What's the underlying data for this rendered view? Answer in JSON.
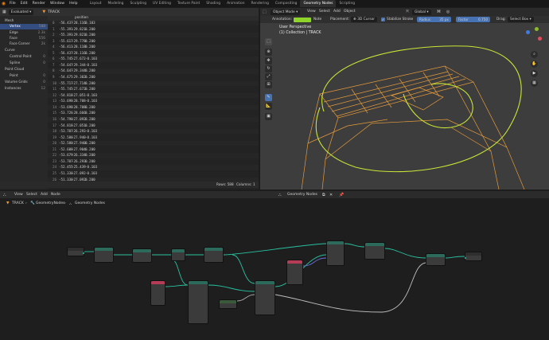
{
  "menu": {
    "logo": "blender-logo-icon",
    "items": [
      "File",
      "Edit",
      "Render",
      "Window",
      "Help"
    ],
    "workspace_tabs": [
      "Layout",
      "Modeling",
      "Sculpting",
      "UV Editing",
      "Texture Paint",
      "Shading",
      "Animation",
      "Rendering",
      "Compositing",
      "Geometry Nodes",
      "Scripting"
    ],
    "active_tab": "Geometry Nodes"
  },
  "spreadsheet": {
    "mode": "Evaluated",
    "object": "TRACK",
    "column_header": "position",
    "tree": [
      {
        "label": "Mesh",
        "count": ""
      },
      {
        "label": "Vertex",
        "count": "588",
        "selected": true
      },
      {
        "label": "Edge",
        "count": "2.3k"
      },
      {
        "label": "Face",
        "count": "556"
      },
      {
        "label": "Face Corner",
        "count": "2k"
      },
      {
        "label": "Curve",
        "count": ""
      },
      {
        "label": "Control Point",
        "count": "0"
      },
      {
        "label": "Spline",
        "count": "0"
      },
      {
        "label": "Point Cloud",
        "count": ""
      },
      {
        "label": "Point",
        "count": "0"
      },
      {
        "label": "Volume Grids",
        "count": "0"
      },
      {
        "label": "Instances",
        "count": "12"
      }
    ],
    "rows": [
      [
        "0",
        "-56.437",
        "-28.116",
        "0.103"
      ],
      [
        "1",
        "-55.391",
        "-29.821",
        "0.200"
      ],
      [
        "2",
        "-55.391",
        "-29.821",
        "0.200"
      ],
      [
        "3",
        "-55.617",
        "-29.778",
        "0.200"
      ],
      [
        "4",
        "-56.411",
        "-28.118",
        "0.200"
      ],
      [
        "5",
        "-56.437",
        "-28.116",
        "0.200"
      ],
      [
        "6",
        "-55.745",
        "-27.672",
        "-0.103"
      ],
      [
        "7",
        "-54.647",
        "-29.344",
        "-0.103"
      ],
      [
        "8",
        "-54.647",
        "-29.344",
        "0.200"
      ],
      [
        "9",
        "-54.675",
        "-29.302",
        "0.200"
      ],
      [
        "10",
        "-55.717",
        "-27.714",
        "0.200"
      ],
      [
        "11",
        "-55.745",
        "-27.672",
        "0.200"
      ],
      [
        "12",
        "-54.818",
        "-27.051",
        "-0.103"
      ],
      [
        "13",
        "-53.698",
        "-28.708",
        "-0.103"
      ],
      [
        "14",
        "-53.698",
        "-28.708",
        "0.200"
      ],
      [
        "15",
        "-53.726",
        "-28.666",
        "0.200"
      ],
      [
        "16",
        "-54.790",
        "-27.092",
        "0.200"
      ],
      [
        "17",
        "-54.818",
        "-27.051",
        "0.200"
      ],
      [
        "18",
        "-53.707",
        "-26.293",
        "-0.103"
      ],
      [
        "19",
        "-52.580",
        "-27.940",
        "-0.103"
      ],
      [
        "20",
        "-52.580",
        "-27.940",
        "0.200"
      ],
      [
        "21",
        "-52.608",
        "-27.904",
        "0.200"
      ],
      [
        "22",
        "-53.679",
        "-26.334",
        "0.200"
      ],
      [
        "23",
        "-53.707",
        "-26.293",
        "0.200"
      ],
      [
        "24",
        "-52.455",
        "-25.439",
        "-0.103"
      ],
      [
        "25",
        "-51.330",
        "-27.092",
        "-0.103"
      ],
      [
        "26",
        "-51.330",
        "-27.092",
        "0.200"
      ],
      [
        "27",
        "-51.358",
        "-27.051",
        "0.200"
      ]
    ],
    "footer": {
      "rows": "Rows: 588",
      "columns": "Columns: 1"
    }
  },
  "viewport": {
    "mode": "Object Mode",
    "menus": [
      "View",
      "Select",
      "Add",
      "Object"
    ],
    "orientation": "Global",
    "tool": {
      "annotation_label": "Annotation:",
      "annotation_color": "#8fd42a",
      "note_label": "Note",
      "placement_label": "Placement:",
      "placement_value": "3D Cursor",
      "stabilize_label": "Stabilize Stroke",
      "radius_label": "Radius",
      "radius_value": "35 px",
      "factor_label": "Factor",
      "factor_value": "0.750",
      "drag_label": "Drag:",
      "drag_value": "Select Box"
    },
    "overlay_title": "User Perspective",
    "overlay_subtitle": "(1) Collection | TRACK"
  },
  "node_editor": {
    "menus": [
      "View",
      "Select",
      "Add",
      "Node"
    ],
    "tree_name": "Geometry Nodes",
    "breadcrumb": [
      "TRACK",
      "GeometryNodes",
      "Geometry Nodes"
    ]
  }
}
